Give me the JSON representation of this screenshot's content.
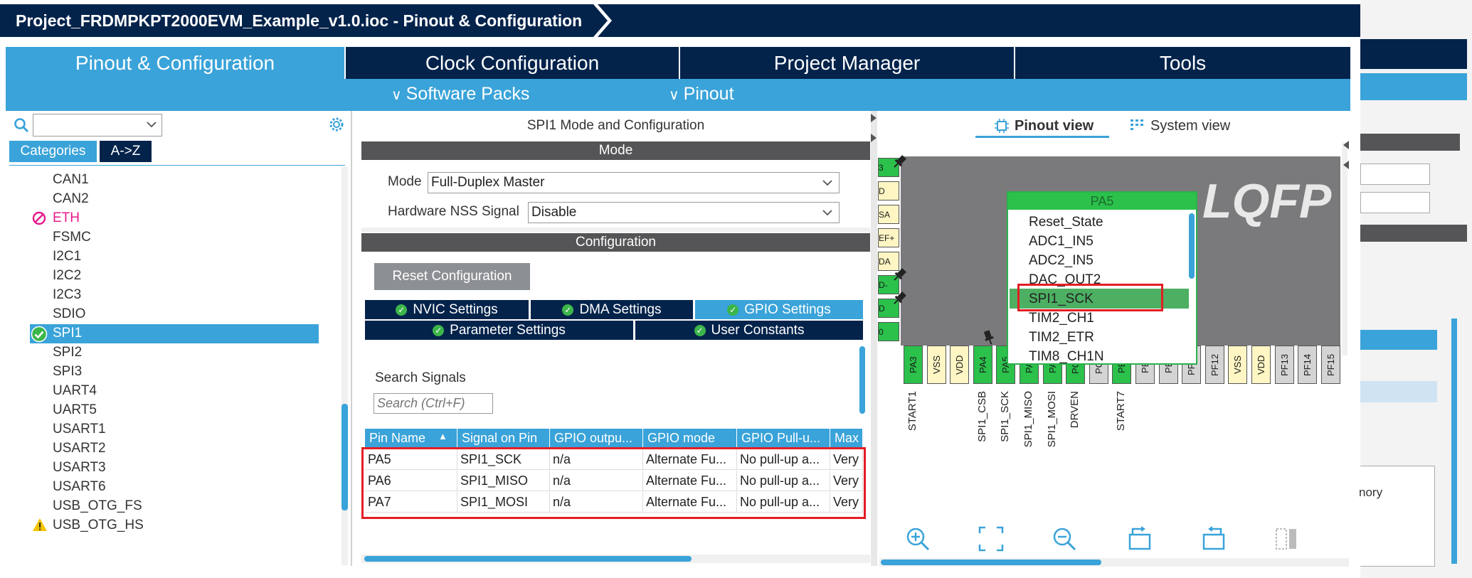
{
  "window": {
    "title": "Project_FRDMPKPT2000EVM_Example_v1.0.ioc - Pinout & Configuration"
  },
  "main_tabs": [
    {
      "label": "Pinout & Configuration"
    },
    {
      "label": "Clock Configuration"
    },
    {
      "label": "Project Manager"
    },
    {
      "label": "Tools"
    }
  ],
  "sub_menu": {
    "software_packs": "Software Packs",
    "pinout": "Pinout"
  },
  "left_panel": {
    "search_value": "",
    "tabs": {
      "categories": "Categories",
      "az": "A->Z"
    },
    "items": [
      {
        "label": "CAN1",
        "status": ""
      },
      {
        "label": "CAN2",
        "status": ""
      },
      {
        "label": "ETH",
        "status": "blocked"
      },
      {
        "label": "FSMC",
        "status": ""
      },
      {
        "label": "I2C1",
        "status": ""
      },
      {
        "label": "I2C2",
        "status": ""
      },
      {
        "label": "I2C3",
        "status": ""
      },
      {
        "label": "SDIO",
        "status": ""
      },
      {
        "label": "SPI1",
        "status": "selected"
      },
      {
        "label": "SPI2",
        "status": ""
      },
      {
        "label": "SPI3",
        "status": ""
      },
      {
        "label": "UART4",
        "status": ""
      },
      {
        "label": "UART5",
        "status": ""
      },
      {
        "label": "USART1",
        "status": ""
      },
      {
        "label": "USART2",
        "status": ""
      },
      {
        "label": "USART3",
        "status": ""
      },
      {
        "label": "USART6",
        "status": ""
      },
      {
        "label": "USB_OTG_FS",
        "status": ""
      },
      {
        "label": "USB_OTG_HS",
        "status": "warning"
      }
    ]
  },
  "mid_panel": {
    "heading": "SPI1 Mode and Configuration",
    "mode_header": "Mode",
    "mode_label": "Mode",
    "mode_value": "Full-Duplex Master",
    "nss_label": "Hardware NSS Signal",
    "nss_value": "Disable",
    "config_header": "Configuration",
    "reset_button": "Reset Configuration",
    "tabs_row1": [
      "NVIC Settings",
      "DMA Settings",
      "GPIO Settings"
    ],
    "tabs_row2": [
      "Parameter Settings",
      "User Constants"
    ],
    "search_label": "Search Signals",
    "search_placeholder": "Search (Ctrl+F)",
    "table": {
      "columns": [
        "Pin Name",
        "Signal on Pin",
        "GPIO outpu...",
        "GPIO mode",
        "GPIO Pull-u...",
        "Max"
      ],
      "rows": [
        [
          "PA5",
          "SPI1_SCK",
          "n/a",
          "Alternate Fu...",
          "No pull-up a...",
          "Very"
        ],
        [
          "PA6",
          "SPI1_MISO",
          "n/a",
          "Alternate Fu...",
          "No pull-up a...",
          "Very"
        ],
        [
          "PA7",
          "SPI1_MOSI",
          "n/a",
          "Alternate Fu...",
          "No pull-up a...",
          "Very"
        ]
      ]
    }
  },
  "right_panel": {
    "pinout_view": "Pinout view",
    "system_view": "System view",
    "package_label": "LQFP",
    "popup": {
      "title": "PA5",
      "options": [
        "Reset_State",
        "ADC1_IN5",
        "ADC2_IN5",
        "DAC_OUT2",
        "SPI1_SCK",
        "TIM2_CH1",
        "TIM2_ETR",
        "TIM8_CH1N"
      ]
    },
    "bottom_pins": [
      "PA3",
      "VSS",
      "VDD",
      "PA4",
      "PA5",
      "PA6",
      "PA7",
      "PC4",
      "PC5",
      "PB0",
      "PB1",
      "PB2",
      "PF11",
      "PF12",
      "VSS",
      "VDD",
      "PF13",
      "PF14",
      "PF15"
    ],
    "left_pins": [
      "3",
      "D",
      "SA",
      "EF+",
      "DA",
      "D-",
      "D",
      "0"
    ],
    "pin_labels": [
      "START1",
      "SPI1_CSB",
      "SPI1_SCK",
      "SPI1_MISO",
      "SPI1_MOSI",
      "DRVEN",
      "START7"
    ]
  },
  "colors": {
    "navy": "#03234b",
    "accent": "#3aa3d9",
    "pin_green": "#2bc14b",
    "highlight": "#e31e24"
  },
  "far_right": {
    "fragment_text": "nory"
  }
}
